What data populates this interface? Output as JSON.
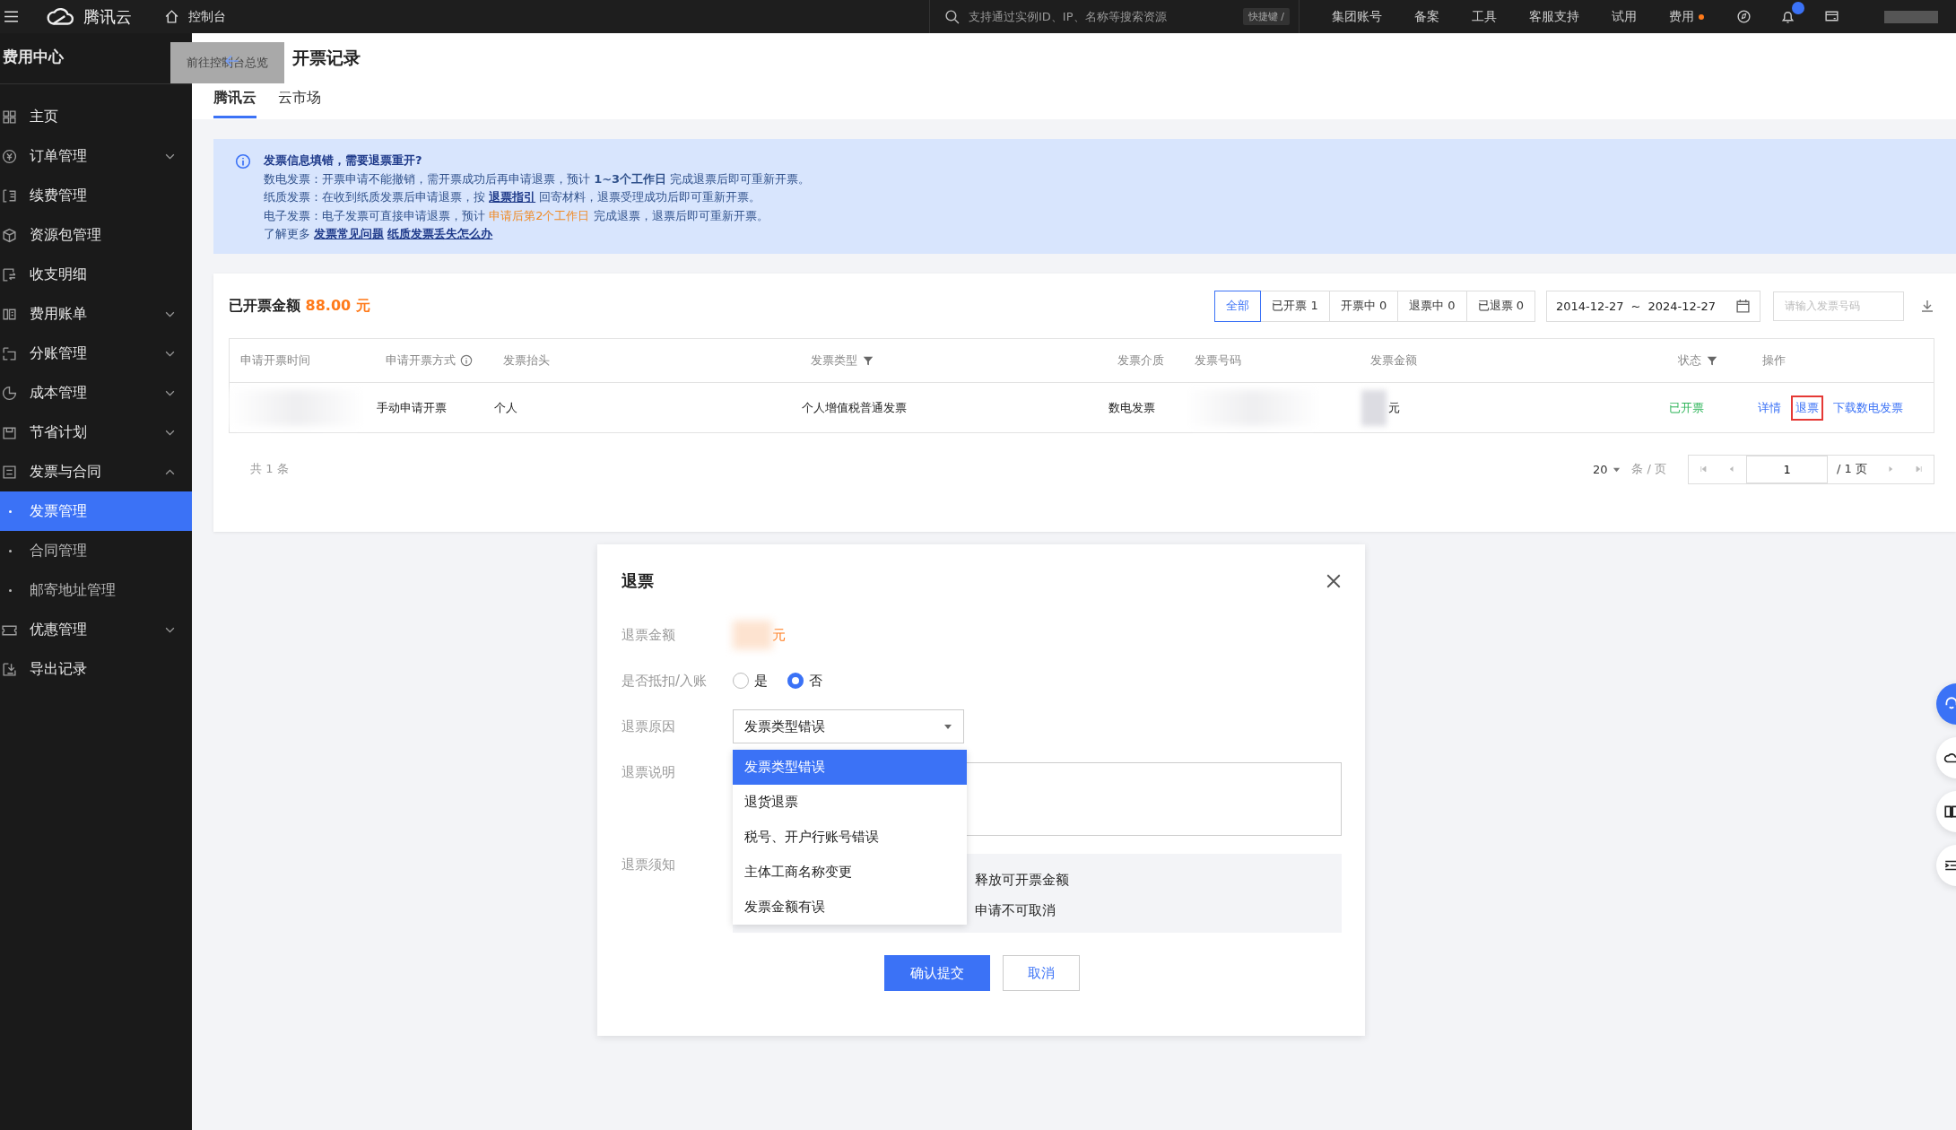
{
  "top_bar": {
    "logo_text": "腾讯云",
    "console": "控制台",
    "search": {
      "placeholder": "支持通过实例ID、IP、名称等搜索资源"
    },
    "shortcut": "快捷键 /",
    "links": [
      {
        "label": "集团账号",
        "dot": false
      },
      {
        "label": "备案",
        "dot": false
      },
      {
        "label": "工具",
        "dot": false
      },
      {
        "label": "客服支持",
        "dot": false
      },
      {
        "label": "试用",
        "dot": false
      },
      {
        "label": "费用",
        "dot": true
      }
    ]
  },
  "sidebar": {
    "title": "费用中心",
    "items": [
      {
        "label": "主页"
      },
      {
        "label": "订单管理",
        "expanded": false
      },
      {
        "label": "续费管理"
      },
      {
        "label": "资源包管理"
      },
      {
        "label": "收支明细"
      },
      {
        "label": "费用账单",
        "expanded": false
      },
      {
        "label": "分账管理",
        "expanded": false
      },
      {
        "label": "成本管理",
        "expanded": false
      },
      {
        "label": "节省计划",
        "expanded": false
      },
      {
        "label": "发票与合同",
        "expanded": true,
        "children": [
          {
            "label": "发票管理",
            "selected": true
          },
          {
            "label": "合同管理",
            "selected": false
          },
          {
            "label": "邮寄地址管理",
            "selected": false
          }
        ]
      },
      {
        "label": "优惠管理",
        "expanded": false
      },
      {
        "label": "导出记录"
      }
    ]
  },
  "tooltip": "前往控制台总览",
  "page": {
    "title": "开票记录",
    "tabs": [
      {
        "label": "腾讯云",
        "selected": true
      },
      {
        "label": "云市场",
        "selected": false
      }
    ]
  },
  "notice": {
    "title": "发票信息填错，需要退票重开?",
    "lines": [
      [
        {
          "kind": "text",
          "text": "数电发票：开票申请不能撤销，需开票成功后再申请退票，预计"
        },
        {
          "kind": "bold",
          "text": "1~3个工作日"
        },
        {
          "kind": "text",
          "text": "完成退票后即可重新开票。"
        }
      ],
      [
        {
          "kind": "text",
          "text": "纸质发票：在收到纸质发票后申请退票，按"
        },
        {
          "kind": "link",
          "text": "退票指引"
        },
        {
          "kind": "text",
          "text": "回寄材料，退票受理成功后即可重新开票。"
        }
      ],
      [
        {
          "kind": "text",
          "text": "电子发票：电子发票可直接申请退票，预计"
        },
        {
          "kind": "warn",
          "text": "申请后第2个工作日"
        },
        {
          "kind": "text",
          "text": "完成退票，退票后即可重新开票。"
        }
      ],
      [
        {
          "kind": "text",
          "text": "了解更多"
        },
        {
          "kind": "link",
          "text": "发票常见问题"
        },
        {
          "kind": "link",
          "text": "纸质发票丢失怎么办"
        }
      ]
    ]
  },
  "summary": {
    "label": "已开票金额",
    "amount": "88.00 元"
  },
  "filters": [
    {
      "label": "全部",
      "selected": true
    },
    {
      "label": "已开票 1",
      "selected": false
    },
    {
      "label": "开票中 0",
      "selected": false
    },
    {
      "label": "退票中 0",
      "selected": false
    },
    {
      "label": "已退票 0",
      "selected": false
    }
  ],
  "date_range": {
    "start": "2014-12-27",
    "separator": "~",
    "end": "2024-12-27"
  },
  "invoice_search": {
    "placeholder": "请输入发票号码"
  },
  "table": {
    "columns": [
      {
        "label": "申请开票时间"
      },
      {
        "label": "申请开票方式",
        "info": true
      },
      {
        "label": "发票抬头"
      },
      {
        "label": "发票类型",
        "filter": true
      },
      {
        "label": "发票介质"
      },
      {
        "label": "发票号码"
      },
      {
        "label": "发票金额"
      },
      {
        "label": "状态",
        "filter": true
      },
      {
        "label": "操作"
      }
    ],
    "rows": [
      {
        "method": "手动申请开票",
        "title": "个人",
        "type": "个人增值税普通发票",
        "medium": "数电发票",
        "amount_unit": "元",
        "status": "已开票",
        "actions": [
          {
            "label": "详情",
            "highlighted": false
          },
          {
            "label": "退票",
            "highlighted": true
          },
          {
            "label": "下载数电发票",
            "highlighted": false
          }
        ]
      }
    ]
  },
  "pagination": {
    "total": "共 1 条",
    "page_size": "20",
    "per_page": "条 / 页",
    "page": "1",
    "pages": "/ 1 页"
  },
  "dialog": {
    "title": "退票",
    "amount_label": "退票金额",
    "amount_unit": "元",
    "deduct_label": "是否抵扣/入账",
    "deduct_options": [
      {
        "label": "是",
        "selected": false
      },
      {
        "label": "否",
        "selected": true
      }
    ],
    "reason_label": "退票原因",
    "reason_value": "发票类型错误",
    "reason_options": [
      {
        "label": "发票类型错误",
        "selected": true
      },
      {
        "label": "退货退票",
        "selected": false
      },
      {
        "label": "税号、开户行账号错误",
        "selected": false
      },
      {
        "label": "主体工商名称变更",
        "selected": false
      },
      {
        "label": "发票金额有误",
        "selected": false
      }
    ],
    "remark_label": "退票说明",
    "terms_label": "退票须知",
    "terms_lines": [
      "释放可开票金额",
      "申请不可取消"
    ],
    "submit": "确认提交",
    "cancel": "取消"
  }
}
